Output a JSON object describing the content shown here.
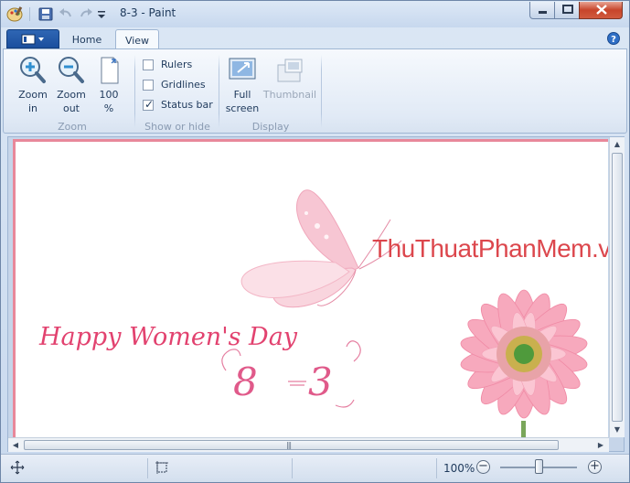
{
  "window": {
    "title": "8-3 - Paint"
  },
  "tabs": {
    "home": "Home",
    "view": "View"
  },
  "ribbon": {
    "zoom_group": {
      "label": "Zoom",
      "zoom_in": [
        "Zoom",
        "in"
      ],
      "zoom_out": [
        "Zoom",
        "out"
      ],
      "actual_size": [
        "100",
        "%"
      ]
    },
    "show_hide_group": {
      "label": "Show or hide",
      "rulers": {
        "label": "Rulers",
        "checked": false
      },
      "gridlines": {
        "label": "Gridlines",
        "checked": false
      },
      "status_bar": {
        "label": "Status bar",
        "checked": true
      }
    },
    "display_group": {
      "label": "Display",
      "full_screen": [
        "Full",
        "screen"
      ],
      "thumbnail": "Thumbnail"
    }
  },
  "canvas": {
    "watermark": "ThuThuatPhanMem.vn",
    "greeting": "Happy Women's Day",
    "date_left": "8",
    "date_right": "3"
  },
  "statusbar": {
    "zoom": "100%",
    "zoom_level": 1.0
  },
  "colors": {
    "accent": "#1b4f9e",
    "canvas_border": "#e8889a",
    "greeting": "#e2426f",
    "watermark": "#d9343a"
  }
}
